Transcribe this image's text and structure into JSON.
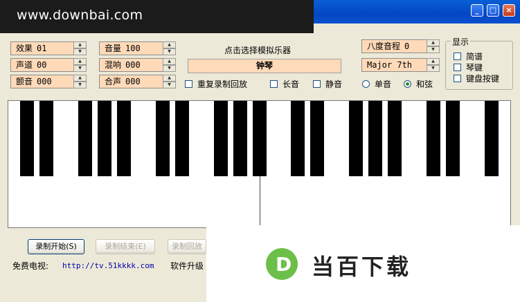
{
  "watermark": "www.downbai.com",
  "window_buttons": {
    "minimize": "_",
    "maximize": "□",
    "close": "×"
  },
  "controls": {
    "effect": {
      "label": "效果",
      "value": "01"
    },
    "channel": {
      "label": "声道",
      "value": "00"
    },
    "vibrato": {
      "label": "颤音",
      "value": "000"
    },
    "volume": {
      "label": "音量",
      "value": "100"
    },
    "reverb": {
      "label": "混响",
      "value": "000"
    },
    "chorus": {
      "label": "合声",
      "value": "000"
    },
    "octave": {
      "label": "八度音程",
      "value": "0"
    },
    "chord_type": {
      "value": "Major 7th"
    }
  },
  "instrument_prompt": "点击选择模拟乐器",
  "instrument_name": "钟琴",
  "checkboxes": {
    "repeat_record": "重复录制回放",
    "long_note": "长音",
    "mute": "静音"
  },
  "radios": {
    "single_note": "单音",
    "chord": "和弦",
    "selected": "chord"
  },
  "display_group": {
    "title": "显示",
    "notation": "简谱",
    "keys": "琴键",
    "keyboard_keys": "键盘按键"
  },
  "buttons": {
    "record_start": "录制开始(S)",
    "record_stop": "录制结束(E)",
    "record_play": "录制回放"
  },
  "footer": {
    "free_tv_label": "免费电视:",
    "free_tv_link": "http://tv.51kkkk.com",
    "upgrade": "软件升级"
  },
  "ad": {
    "logo_letter": "D",
    "text": "当百下载",
    "logo_color": "#6CC04A"
  },
  "piano": {
    "white_keys": 26,
    "black_key_pattern": [
      1,
      1,
      0,
      1,
      1,
      1,
      0
    ]
  }
}
